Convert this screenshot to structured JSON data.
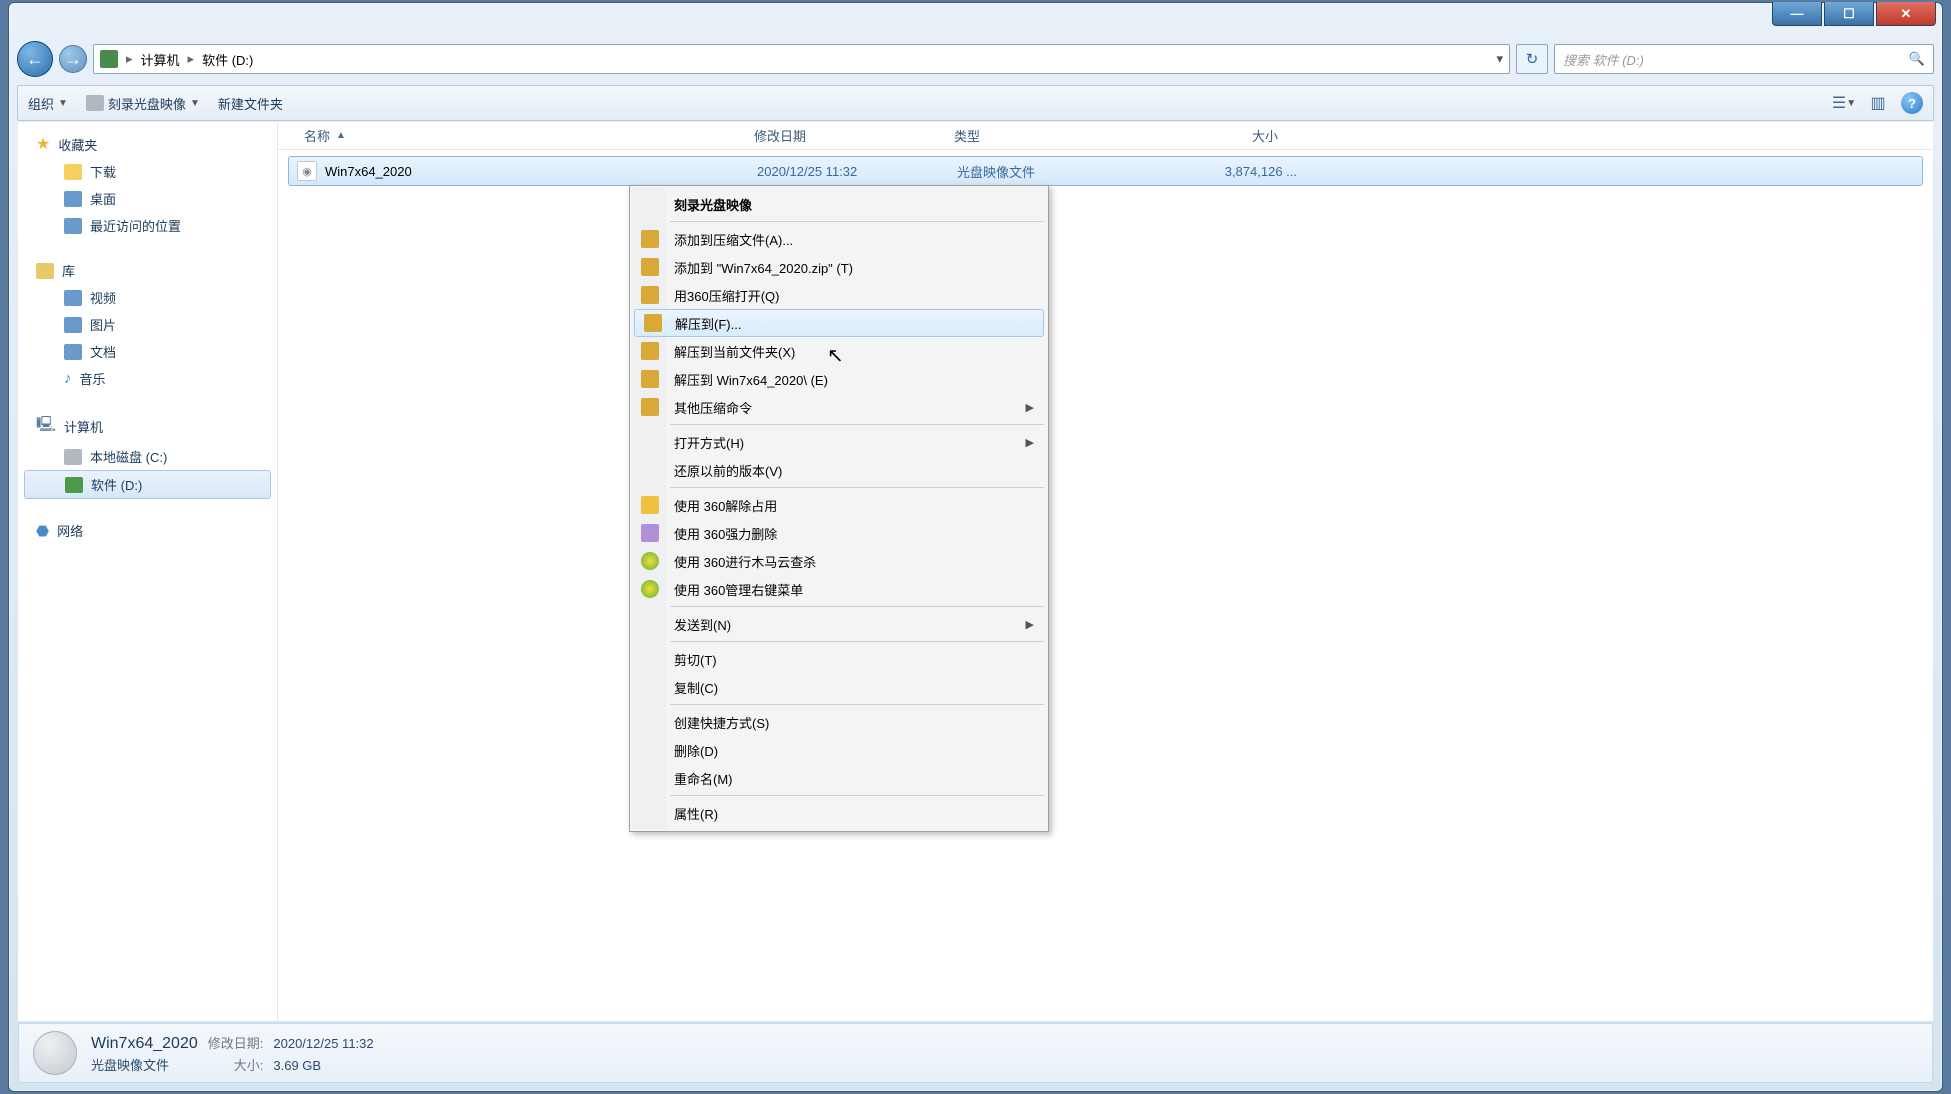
{
  "breadcrumb": {
    "root": "计算机",
    "loc": "软件 (D:)"
  },
  "search": {
    "placeholder": "搜索 软件 (D:)"
  },
  "toolbar": {
    "organize": "组织",
    "burn": "刻录光盘映像",
    "newfolder": "新建文件夹"
  },
  "columns": {
    "name": "名称",
    "date": "修改日期",
    "type": "类型",
    "size": "大小"
  },
  "sidebar": {
    "fav": "收藏夹",
    "fav_items": {
      "downloads": "下载",
      "desktop": "桌面",
      "recent": "最近访问的位置"
    },
    "lib": "库",
    "lib_items": {
      "video": "视频",
      "pic": "图片",
      "doc": "文档",
      "music": "音乐"
    },
    "comp": "计算机",
    "comp_items": {
      "c": "本地磁盘 (C:)",
      "d": "软件 (D:)"
    },
    "net": "网络"
  },
  "file": {
    "name": "Win7x64_2020",
    "date": "2020/12/25 11:32",
    "type": "光盘映像文件",
    "size": "3,874,126 ..."
  },
  "ctx": {
    "burn": "刻录光盘映像",
    "addto": "添加到压缩文件(A)...",
    "addzip": "添加到 \"Win7x64_2020.zip\" (T)",
    "open360": "用360压缩打开(Q)",
    "extractto": "解压到(F)...",
    "extracthere": "解压到当前文件夹(X)",
    "extractfolder": "解压到 Win7x64_2020\\ (E)",
    "othercomp": "其他压缩命令",
    "openwith": "打开方式(H)",
    "restore": "还原以前的版本(V)",
    "unlock360": "使用 360解除占用",
    "forcedel360": "使用 360强力删除",
    "trojan360": "使用 360进行木马云查杀",
    "menu360": "使用 360管理右键菜单",
    "sendto": "发送到(N)",
    "cut": "剪切(T)",
    "copy": "复制(C)",
    "shortcut": "创建快捷方式(S)",
    "delete": "删除(D)",
    "rename": "重命名(M)",
    "props": "属性(R)"
  },
  "details": {
    "title": "Win7x64_2020",
    "type": "光盘映像文件",
    "date_lab": "修改日期:",
    "date_val": "2020/12/25 11:32",
    "size_lab": "大小:",
    "size_val": "3.69 GB"
  }
}
